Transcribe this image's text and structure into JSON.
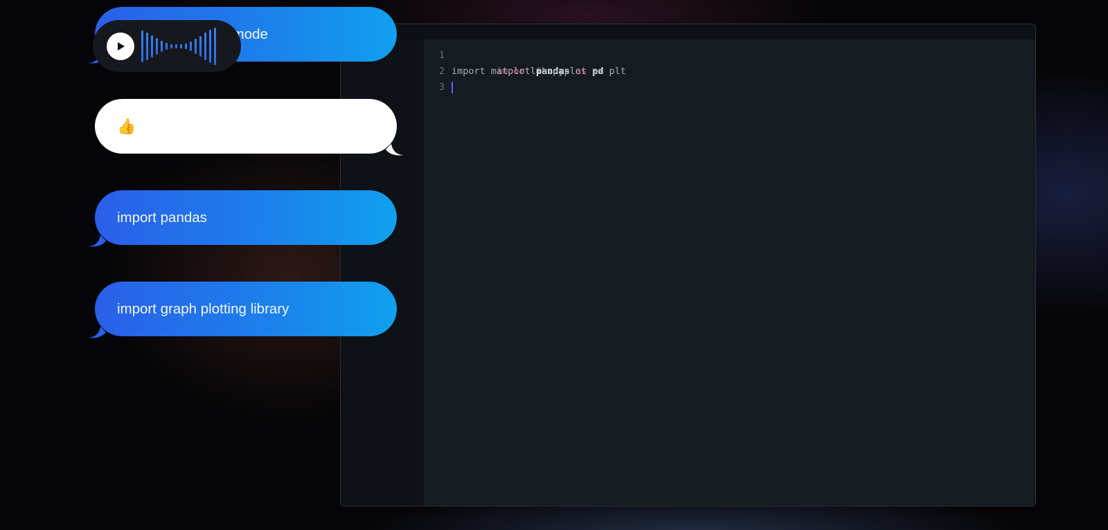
{
  "chat": {
    "bubble_1": {
      "text": "le mode",
      "style": "blue"
    },
    "bubble_2": {
      "emoji": "👍",
      "style": "white"
    },
    "bubble_3": {
      "text": "import pandas",
      "style": "blue"
    },
    "bubble_4": {
      "text": "import graph plotting library",
      "style": "blue"
    },
    "voice_message": {
      "icon": "play-icon"
    }
  },
  "editor": {
    "lines": [
      {
        "no": "1",
        "tokens": [
          {
            "t": "import",
            "c": "kw"
          },
          {
            "t": " ",
            "c": "plain"
          },
          {
            "t": "pandas",
            "c": "id"
          },
          {
            "t": " ",
            "c": "plain"
          },
          {
            "t": "as",
            "c": "kw"
          },
          {
            "t": " ",
            "c": "plain"
          },
          {
            "t": "pd",
            "c": "id"
          }
        ]
      },
      {
        "no": "2",
        "tokens": [
          {
            "t": "import matplotlib.pyplot as plt",
            "c": "plain"
          }
        ]
      },
      {
        "no": "3",
        "tokens": []
      }
    ]
  },
  "colors": {
    "bubble_gradient_start": "#2a5fe8",
    "bubble_gradient_end": "#11a0ee",
    "keyword": "#e05a7a",
    "caret": "#6b5cff"
  }
}
